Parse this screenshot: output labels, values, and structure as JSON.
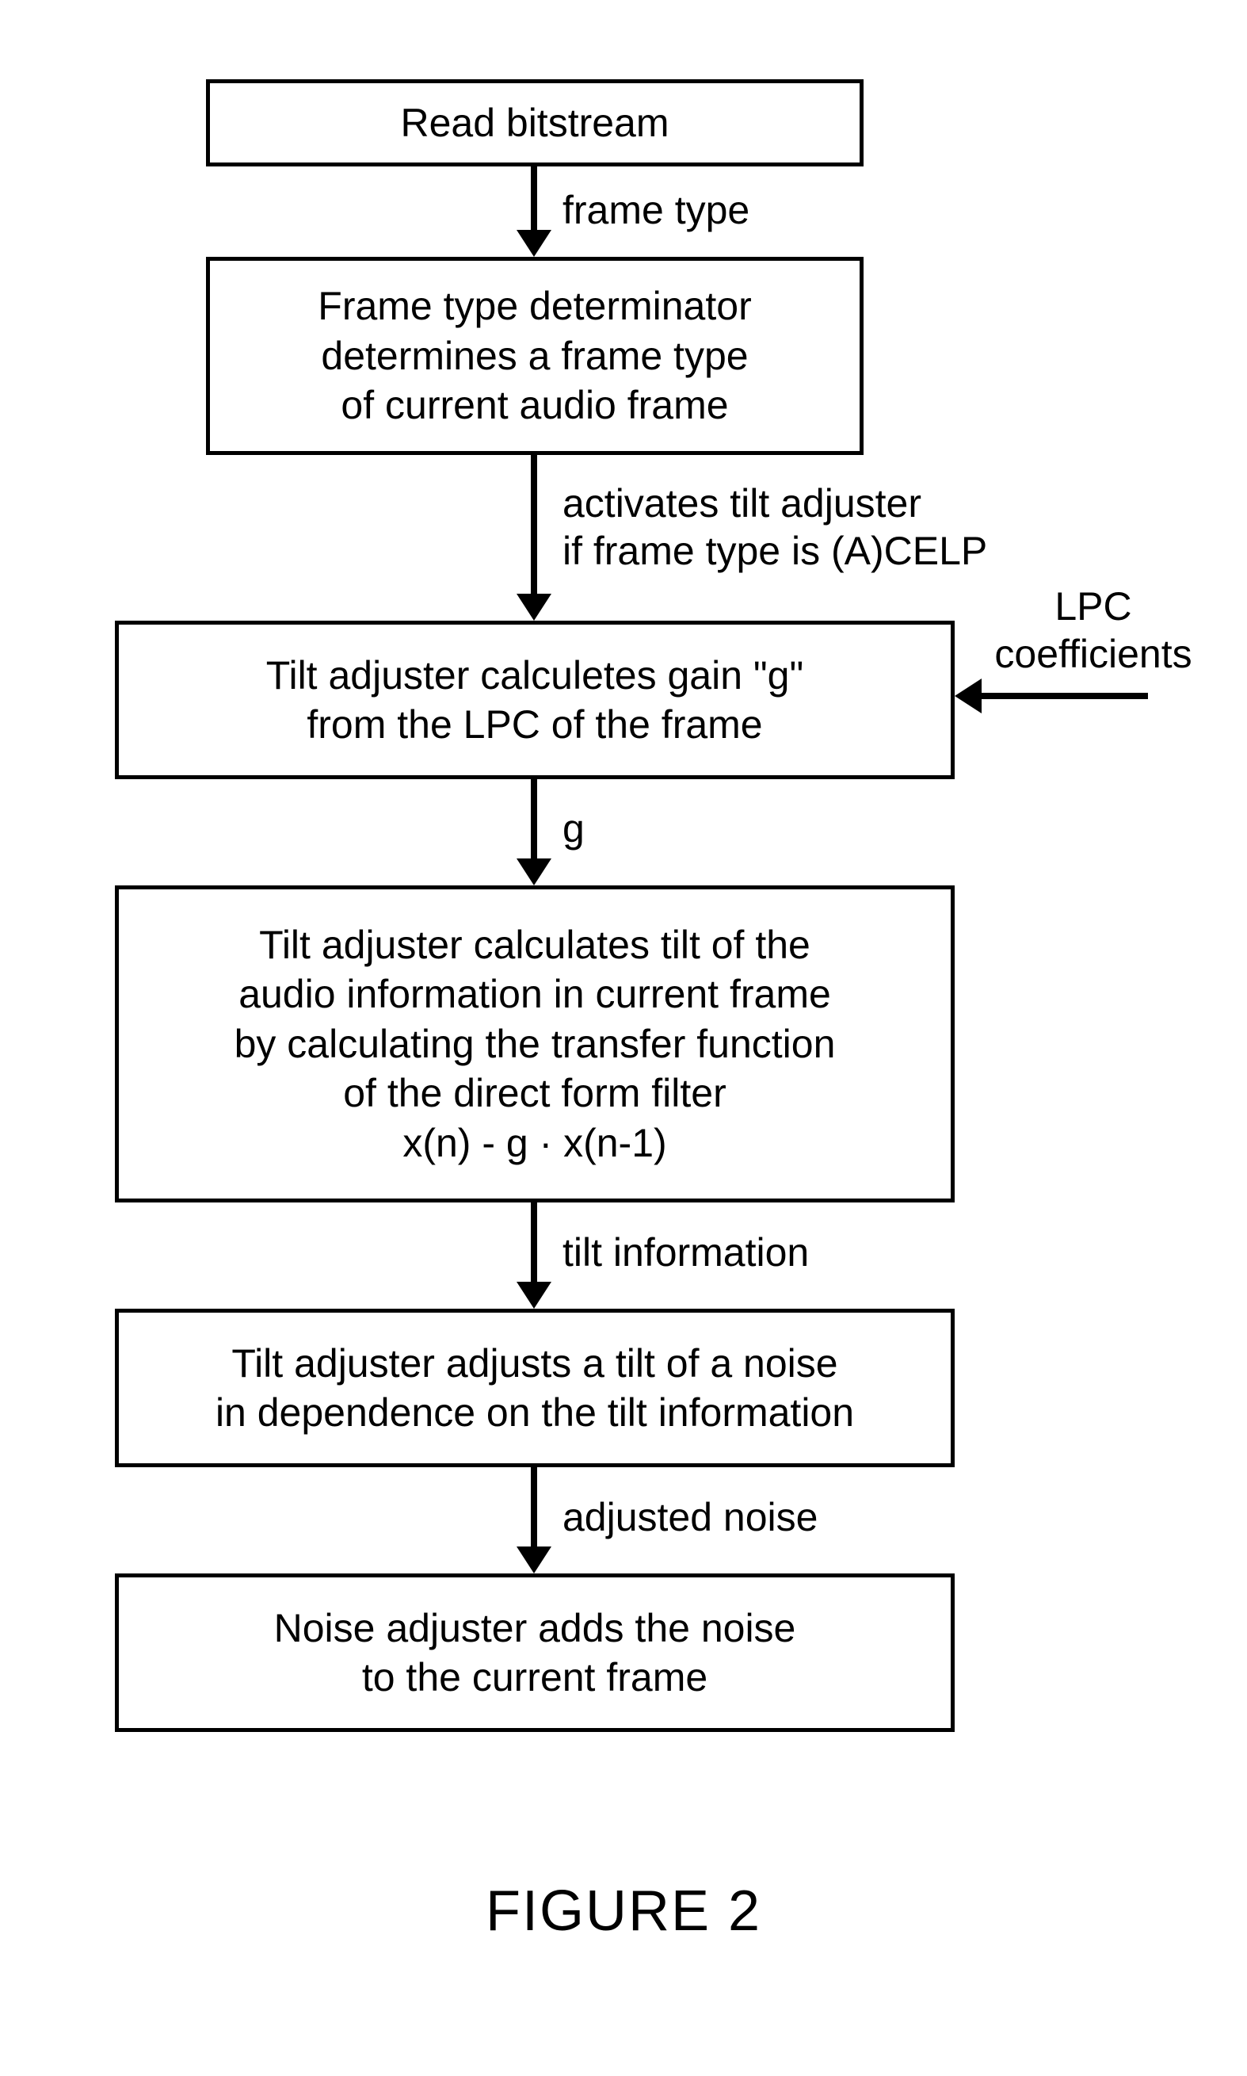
{
  "boxes": {
    "b1": "Read bitstream",
    "b2": "Frame type determinator\ndetermines a frame type\nof current audio frame",
    "b3": "Tilt adjuster calculetes gain \"g\"\nfrom the LPC of the frame",
    "b4": "Tilt adjuster calculates tilt of the\naudio information in current frame\nby calculating the transfer function\nof the direct form filter\nx(n) - g · x(n-1)",
    "b5": "Tilt adjuster adjusts a tilt of a noise\nin dependence on the tilt information",
    "b6": "Noise adjuster adds the noise\nto the current frame"
  },
  "arrows": {
    "a1": "frame type",
    "a2": "activates tilt adjuster\nif frame type is (A)CELP",
    "a3": "g",
    "a4": "tilt information",
    "a5": "adjusted noise",
    "lpc": "LPC\ncoefficients"
  },
  "figure": "FIGURE 2"
}
